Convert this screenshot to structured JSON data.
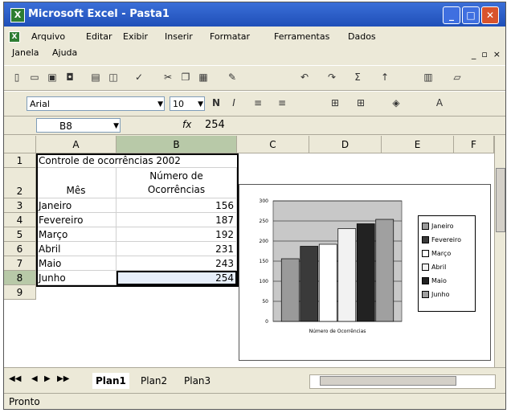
{
  "window": {
    "title": "Microsoft Excel - Pasta1"
  },
  "menu": {
    "row1": [
      "Arquivo",
      "Editar",
      "Exibir",
      "Inserir",
      "Formatar",
      "Ferramentas",
      "Dados"
    ],
    "row2": [
      "Janela",
      "Ajuda"
    ]
  },
  "format_toolbar": {
    "font": "Arial",
    "size": "10"
  },
  "formula_bar": {
    "cell_ref": "B8",
    "fx": "fx",
    "value": "254"
  },
  "columns": [
    "A",
    "B",
    "C",
    "D",
    "E",
    "F"
  ],
  "rows": [
    "1",
    "2",
    "3",
    "4",
    "5",
    "6",
    "7",
    "8",
    "9"
  ],
  "sheet": {
    "a1": "Controle de ocorrências 2002",
    "a2": "Mês",
    "b2_line1": "Número de",
    "b2_line2": "Ocorrências",
    "data": [
      {
        "month": "Janeiro",
        "value": "156"
      },
      {
        "month": "Fevereiro",
        "value": "187"
      },
      {
        "month": "Março",
        "value": "192"
      },
      {
        "month": "Abril",
        "value": "231"
      },
      {
        "month": "Maio",
        "value": "243"
      },
      {
        "month": "Junho",
        "value": "254"
      }
    ]
  },
  "chart_data": {
    "type": "bar",
    "categories": [
      "Número de Ocorrências"
    ],
    "series": [
      {
        "name": "Janeiro",
        "values": [
          156
        ]
      },
      {
        "name": "Fevereiro",
        "values": [
          187
        ]
      },
      {
        "name": "Março",
        "values": [
          192
        ]
      },
      {
        "name": "Abril",
        "values": [
          231
        ]
      },
      {
        "name": "Maio",
        "values": [
          243
        ]
      },
      {
        "name": "Junho",
        "values": [
          254
        ]
      }
    ],
    "xlabel": "Número de Ocorrências",
    "ylim": [
      0,
      300
    ],
    "yticks": [
      "0",
      "50",
      "100",
      "150",
      "200",
      "250",
      "300"
    ],
    "legend": "right",
    "grid": true,
    "colors": [
      "#9a9a9a",
      "#3a3a3a",
      "#ffffff",
      "#f2f2f2",
      "#222222",
      "#a0a0a0"
    ]
  },
  "sheet_tabs": [
    "Plan1",
    "Plan2",
    "Plan3"
  ],
  "status": "Pronto"
}
